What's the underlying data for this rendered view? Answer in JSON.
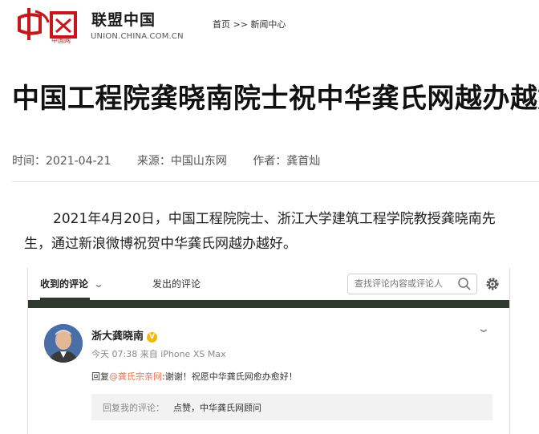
{
  "header": {
    "logo_text": "中国网",
    "site_name": "联盟中国",
    "site_domain": "UNION.CHINA.COM.CN",
    "breadcrumb": {
      "home": "首页",
      "separator": ">>",
      "section": "新闻中心"
    }
  },
  "article": {
    "title": "中国工程院龚晓南院士祝中华龚氏网越办越好",
    "meta": {
      "time": "时间：2021-04-21",
      "source": "来源：中国山东网",
      "author": "作者：龚首灿"
    },
    "paragraph": "2021年4月20日，中国工程院院士、浙江大学建筑工程学院教授龚晓南先生，通过新浪微博祝贺中华龚氏网越办越好。"
  },
  "weibo": {
    "tabs": {
      "received": "收到的评论",
      "sent": "发出的评论"
    },
    "search_placeholder": "查找评论内容或评论人",
    "comment": {
      "user": "浙大龚晓南",
      "verified_icon": "V",
      "time": "今天 07:38 来自 iPhone XS Max",
      "reply_prefix": "回复",
      "mention": "@龚氏宗亲网",
      "reply_text": ":谢谢！祝愿中华龚氏网愈办愈好！",
      "quote_label": "回复我的评论：",
      "quote_text": "点赞，中华龚氏网顾问"
    }
  },
  "colors": {
    "brand_red": "#c8161d",
    "mention": "#eb7350",
    "verified": "#f5b800",
    "dark_band": "#2f3a2f"
  }
}
